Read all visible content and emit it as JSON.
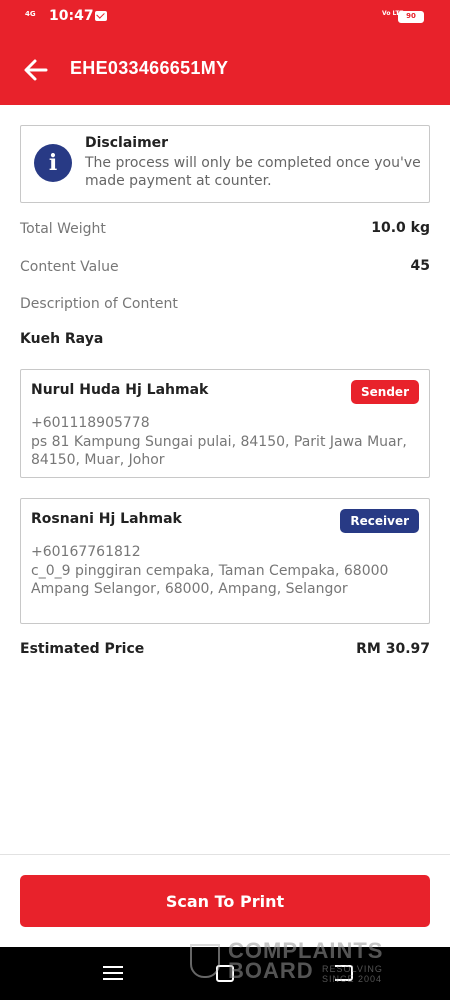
{
  "status_bar": {
    "network": "4G",
    "time": "10:47",
    "volte": "Vo LTE",
    "battery": "90"
  },
  "header": {
    "tracking_number": "EHE033466651MY",
    "back_icon": "arrow-left-icon"
  },
  "disclaimer": {
    "icon": "info-icon",
    "title": "Disclaimer",
    "text": "The process will only be completed once you've made payment at counter."
  },
  "details": {
    "total_weight_label": "Total Weight",
    "total_weight_value": "10.0 kg",
    "content_value_label": "Content Value",
    "content_value_value": "45",
    "description_label": "Description of Content",
    "description_value": "Kueh Raya"
  },
  "sender": {
    "name": "Nurul Huda Hj Lahmak",
    "badge": "Sender",
    "phone": "+601118905778",
    "address": "ps 81 Kampung Sungai pulai, 84150, Parit Jawa Muar, 84150, Muar, Johor"
  },
  "receiver": {
    "name": "Rosnani Hj Lahmak",
    "badge": "Receiver",
    "phone": "+60167761812",
    "address": "c_0_9  pinggiran cempaka, Taman Cempaka, 68000 Ampang Selangor, 68000, Ampang, Selangor"
  },
  "price": {
    "label": "Estimated Price",
    "value": "RM 30.97"
  },
  "actions": {
    "scan_label": "Scan To Print"
  },
  "watermark": {
    "line1": "COMPLAINTS",
    "line2": "BOARD",
    "tagline1": "RESOLVING",
    "tagline2": "SINCE 2004"
  },
  "colors": {
    "brand_red": "#e8222b",
    "receiver_blue": "#283a85"
  }
}
